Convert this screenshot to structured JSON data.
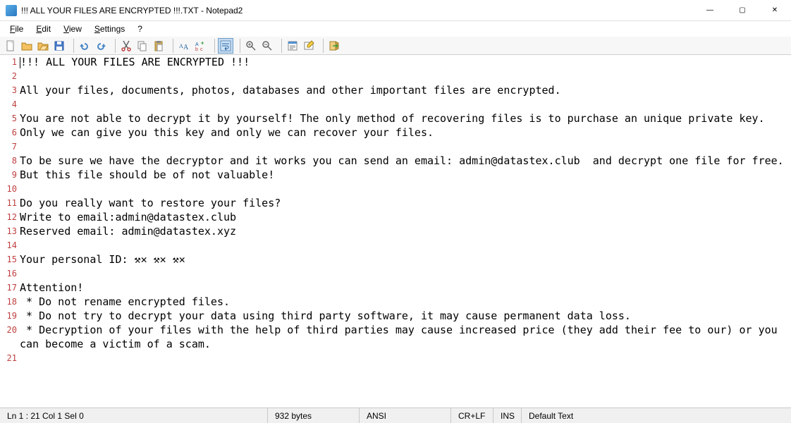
{
  "window": {
    "title": "!!! ALL YOUR FILES ARE ENCRYPTED !!!.TXT - Notepad2"
  },
  "menu": {
    "file": "File",
    "edit": "Edit",
    "view": "View",
    "settings": "Settings",
    "help": "?"
  },
  "toolbar_icons": [
    "new-file-icon",
    "open-file-icon",
    "browse-icon",
    "save-icon",
    "sep",
    "undo-icon",
    "redo-icon",
    "sep",
    "cut-icon",
    "copy-icon",
    "paste-icon",
    "sep",
    "find-icon",
    "replace-icon",
    "sep",
    "word-wrap-icon",
    "sep",
    "zoom-in-icon",
    "zoom-out-icon",
    "sep",
    "scheme-icon",
    "customize-icon",
    "sep",
    "exit-icon"
  ],
  "document": {
    "lines": [
      "!!! ALL YOUR FILES ARE ENCRYPTED !!!",
      "",
      "All your files, documents, photos, databases and other important files are encrypted.",
      "",
      "You are not able to decrypt it by yourself! The only method of recovering files is to purchase an unique private key.",
      "Only we can give you this key and only we can recover your files.",
      "",
      "To be sure we have the decryptor and it works you can send an email: admin@datastex.club  and decrypt one file for free.",
      "But this file should be of not valuable!",
      "",
      "Do you really want to restore your files?",
      "Write to email:admin@datastex.club",
      "Reserved email: admin@datastex.xyz",
      "",
      "Your personal ID: ⚒✕ ⚒✕ ⚒✕",
      "",
      "Attention!",
      " * Do not rename encrypted files.",
      " * Do not try to decrypt your data using third party software, it may cause permanent data loss.",
      " * Decryption of your files with the help of third parties may cause increased price (they add their fee to our) or you can become a victim of a scam.",
      ""
    ]
  },
  "status": {
    "pos": "Ln 1 : 21   Col 1   Sel 0",
    "size": "932 bytes",
    "encoding": "ANSI",
    "eol": "CR+LF",
    "ovr": "INS",
    "lexer": "Default Text"
  }
}
